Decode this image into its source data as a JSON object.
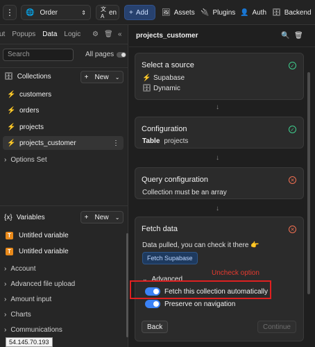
{
  "topbar": {
    "page_select": "Order",
    "lang": "en",
    "add": "Add",
    "assets": "Assets",
    "plugins": "Plugins",
    "auth": "Auth",
    "backend": "Backend"
  },
  "left_tabs": [
    "ut",
    "Popups",
    "Data",
    "Logic"
  ],
  "search": {
    "placeholder": "Search"
  },
  "all_pages": "All pages",
  "collections": {
    "title": "Collections",
    "new": "New",
    "items": [
      "customers",
      "orders",
      "projects",
      "projects_customer"
    ]
  },
  "options_set": "Options Set",
  "variables": {
    "title": "Variables",
    "new": "New",
    "items": [
      "Untitled variable",
      "Untitled variable"
    ],
    "groups": [
      "Account",
      "Advanced file upload",
      "Amount input",
      "Charts",
      "Communications"
    ]
  },
  "ip_tooltip": "54.145.70.193",
  "panel": {
    "title": "projects_customer",
    "source": {
      "title": "Select a source",
      "supabase": "Supabase",
      "dynamic": "Dynamic"
    },
    "configuration": {
      "title": "Configuration",
      "table_label": "Table",
      "table_value": "projects"
    },
    "query": {
      "title": "Query configuration",
      "message": "Collection must be an array"
    },
    "fetch": {
      "title": "Fetch data",
      "message": "Data pulled, you can check it there 👉",
      "fetch_button": "Fetch Supabase",
      "advanced": "Advanced",
      "auto_fetch": "Fetch this collection automatically",
      "preserve": "Preserve on navigation",
      "back": "Back",
      "continue": "Continue"
    }
  },
  "annotation": "Uncheck option",
  "colors": {
    "accent_green": "#3fcf8e",
    "accent_blue": "#3b82f6",
    "error": "#f27052",
    "annotation_red": "#e02020"
  }
}
